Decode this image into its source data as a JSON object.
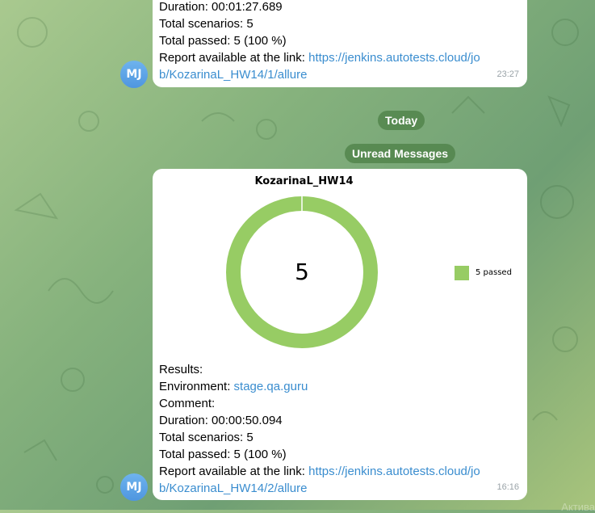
{
  "message1": {
    "lines": [
      {
        "label": "Duration:",
        "value": " 00:01:27.689"
      },
      {
        "label": "Total scenarios:",
        "value": " 5"
      },
      {
        "label": "Total passed:",
        "value": " 5 (100 %)"
      }
    ],
    "report_label": "Report available at the link: ",
    "report_link_part1": "https://jenkins.autotests.cloud/jo",
    "report_link_part2": "b/KozarinaL_HW14/1/allure",
    "time": "23:27"
  },
  "avatar_initials": "MJ",
  "divider_today": "Today",
  "divider_unread": "Unread Messages",
  "message2": {
    "chart_title": "KozarinaL_HW14",
    "center_value": "5",
    "legend_label": "5 passed",
    "results_label": "Results:",
    "environment_label": "Environment: ",
    "environment_value": "stage.qa.guru",
    "comment_label": "Comment:",
    "lines": [
      {
        "label": "Duration:",
        "value": " 00:00:50.094"
      },
      {
        "label": "Total scenarios:",
        "value": " 5"
      },
      {
        "label": "Total passed:",
        "value": " 5 (100 %)"
      }
    ],
    "report_label": "Report available at the link: ",
    "report_link_part1": "https://jenkins.autotests.cloud/jo",
    "report_link_part2": "b/KozarinaL_HW14/2/allure",
    "time": "16:16"
  },
  "colors": {
    "passed": "#97cc64",
    "link": "#3a8dcf",
    "avatar": "#5aa2e6"
  },
  "chart_data": {
    "type": "pie",
    "title": "KozarinaL_HW14",
    "categories": [
      "passed"
    ],
    "values": [
      5
    ],
    "legend": [
      "5 passed"
    ],
    "legend_position": "right"
  },
  "watermark": "Актива"
}
